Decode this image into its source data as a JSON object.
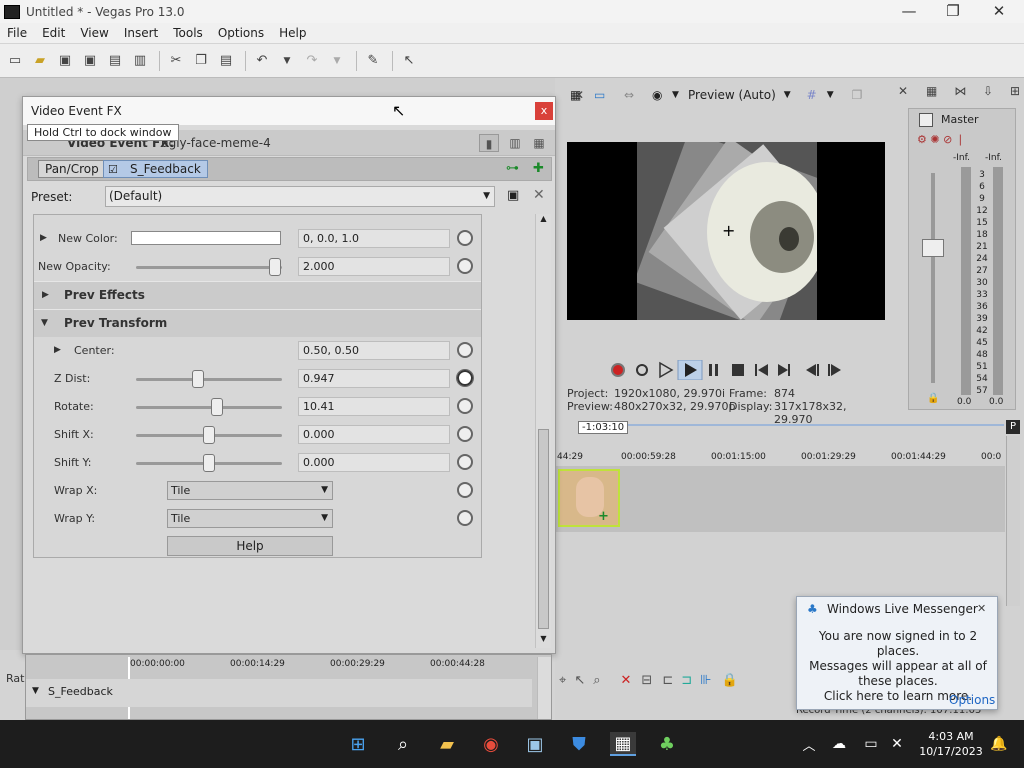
{
  "window": {
    "title": "Untitled * - Vegas Pro 13.0"
  },
  "menu": [
    "File",
    "Edit",
    "View",
    "Insert",
    "Tools",
    "Options",
    "Help"
  ],
  "fx": {
    "title": "Video Event FX",
    "close": "x",
    "tooltip": "Hold Ctrl to dock window",
    "header_label": "Video Event FX:",
    "event_name": "ugly-face-meme-4",
    "chain": [
      "Pan/Crop",
      "S_Feedback"
    ],
    "preset_label": "Preset:",
    "preset_value": "(Default)",
    "help": "Help",
    "params": {
      "new_color": {
        "label": "New Color:",
        "value": "0, 0.0, 1.0"
      },
      "new_opacity": {
        "label": "New Opacity:",
        "value": "2.000",
        "level": 0.99
      },
      "prev_effects": "Prev Effects",
      "prev_transform": "Prev Transform",
      "center": {
        "label": "Center:",
        "value": "0.50, 0.50"
      },
      "z_dist": {
        "label": "Z Dist:",
        "value": "0.947",
        "level": 0.42
      },
      "rotate": {
        "label": "Rotate:",
        "value": "10.41",
        "level": 0.56
      },
      "shift_x": {
        "label": "Shift X:",
        "value": "0.000",
        "level": 0.5
      },
      "shift_y": {
        "label": "Shift Y:",
        "value": "0.000",
        "level": 0.5
      },
      "wrap_x": {
        "label": "Wrap X:",
        "value": "Tile"
      },
      "wrap_y": {
        "label": "Wrap Y:",
        "value": "Tile"
      }
    },
    "timeline": {
      "ticks": [
        "00:00:00:00",
        "00:00:14:29",
        "00:00:29:29",
        "00:00:44:28"
      ],
      "track": "S_Feedback"
    }
  },
  "left_label": "Rat",
  "preview": {
    "mode": "Preview (Auto)",
    "project_label": "Project:",
    "project_value": "1920x1080, 29.970i",
    "frame_label": "Frame:",
    "frame_value": "874",
    "preview_label": "Preview:",
    "preview_value": "480x270x32, 29.970p",
    "display_label": "Display:",
    "display_value": "317x178x32, 29.970"
  },
  "master": {
    "title": "Master",
    "inf_left": "-Inf.",
    "inf_right": "-Inf.",
    "scale": [
      "3",
      "6",
      "9",
      "12",
      "15",
      "18",
      "21",
      "24",
      "27",
      "30",
      "33",
      "36",
      "39",
      "42",
      "45",
      "48",
      "51",
      "54",
      "57"
    ],
    "zero_left": "0.0",
    "zero_right": "0.0"
  },
  "timeline": {
    "timecode": "-1:03:10",
    "ticks": [
      "44:29",
      "00:00:59:28",
      "00:01:15:00",
      "00:01:29:29",
      "00:01:44:29",
      "00:0"
    ]
  },
  "notification": {
    "title": "Windows Live Messenger",
    "close": "✕",
    "line1": "You are now signed in to 2 places.",
    "line2": "Messages will appear at all of these places.",
    "line3": "Click here to learn more.",
    "options": "Options",
    "behind": "Record Time (2 channels): 107:11:05"
  },
  "taskbar": {
    "time": "4:03 AM",
    "date": "10/17/2023"
  }
}
